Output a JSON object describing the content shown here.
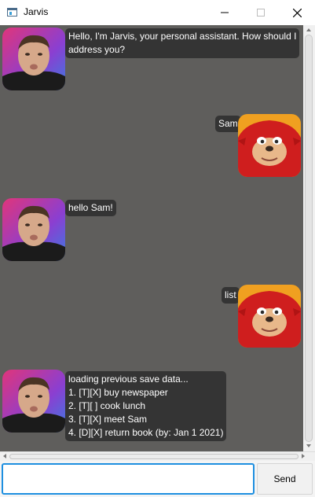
{
  "window": {
    "title": "Jarvis"
  },
  "messages": [
    {
      "sender": "bot",
      "text": "Hello, I'm Jarvis, your personal assistant. How should I\naddress you?"
    },
    {
      "sender": "user",
      "text": "Sam"
    },
    {
      "sender": "bot",
      "text": "hello Sam!"
    },
    {
      "sender": "user",
      "text": "list"
    },
    {
      "sender": "bot",
      "text": "loading previous save data...\n1. [T][X] buy newspaper\n2. [T][ ] cook lunch\n3. [T][X] meet Sam\n4. [D][X] return book (by: Jan 1 2021)"
    }
  ],
  "input": {
    "value": "",
    "placeholder": ""
  },
  "send_label": "Send",
  "colors": {
    "chat_bg": "#5f5e5c",
    "bubble_bg": "#343434",
    "input_border": "#1e8fe0"
  },
  "icons": {
    "bot_avatar": "person-portrait-avatar",
    "user_avatar": "red-echidna-avatar"
  }
}
